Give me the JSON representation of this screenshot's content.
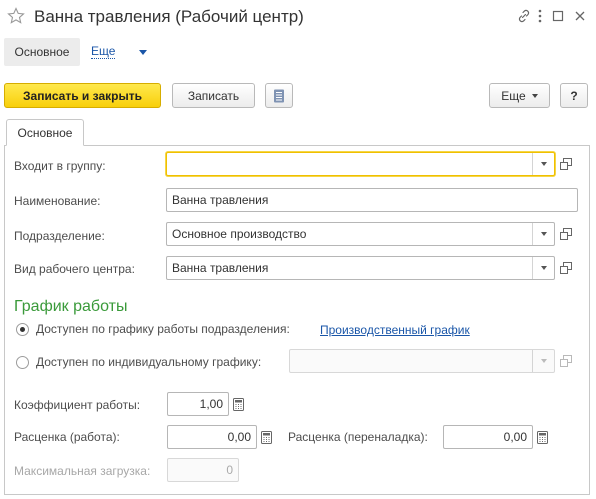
{
  "window": {
    "title": "Ванна травления (Рабочий центр)",
    "icons": [
      "star-icon",
      "link-icon",
      "more-vertical-icon",
      "maximize-icon",
      "close-icon"
    ]
  },
  "nav": {
    "main_tab": "Основное",
    "more_label": "Еще"
  },
  "toolbar": {
    "save_close_label": "Записать и закрыть",
    "save_label": "Записать",
    "more_label": "Еще",
    "help_label": "?"
  },
  "tab": {
    "label": "Основное"
  },
  "form": {
    "group_label": "Входит в группу:",
    "group_value": "",
    "name_label": "Наименование:",
    "name_value": "Ванна травления",
    "division_label": "Подразделение:",
    "division_value": "Основное производство",
    "type_label": "Вид рабочего центра:",
    "type_value": "Ванна травления"
  },
  "schedule": {
    "title": "График работы",
    "option1_label": "Доступен по графику работы подразделения:",
    "option1_link": "Производственный график",
    "option1_selected": true,
    "option2_label": "Доступен по индивидуальному графику:",
    "option2_value": "",
    "option2_selected": false
  },
  "params": {
    "coef_label": "Коэффициент работы:",
    "coef_value": "1,00",
    "rate_work_label": "Расценка (работа):",
    "rate_work_value": "0,00",
    "rate_setup_label": "Расценка (переналадка):",
    "rate_setup_value": "0,00",
    "max_load_label": "Максимальная загрузка:",
    "max_load_value": "0"
  },
  "colors": {
    "primary_button": "#f8cf0b",
    "section_title": "#3a9a3a",
    "link": "#1a56a8",
    "focus_border": "#f0c000"
  }
}
